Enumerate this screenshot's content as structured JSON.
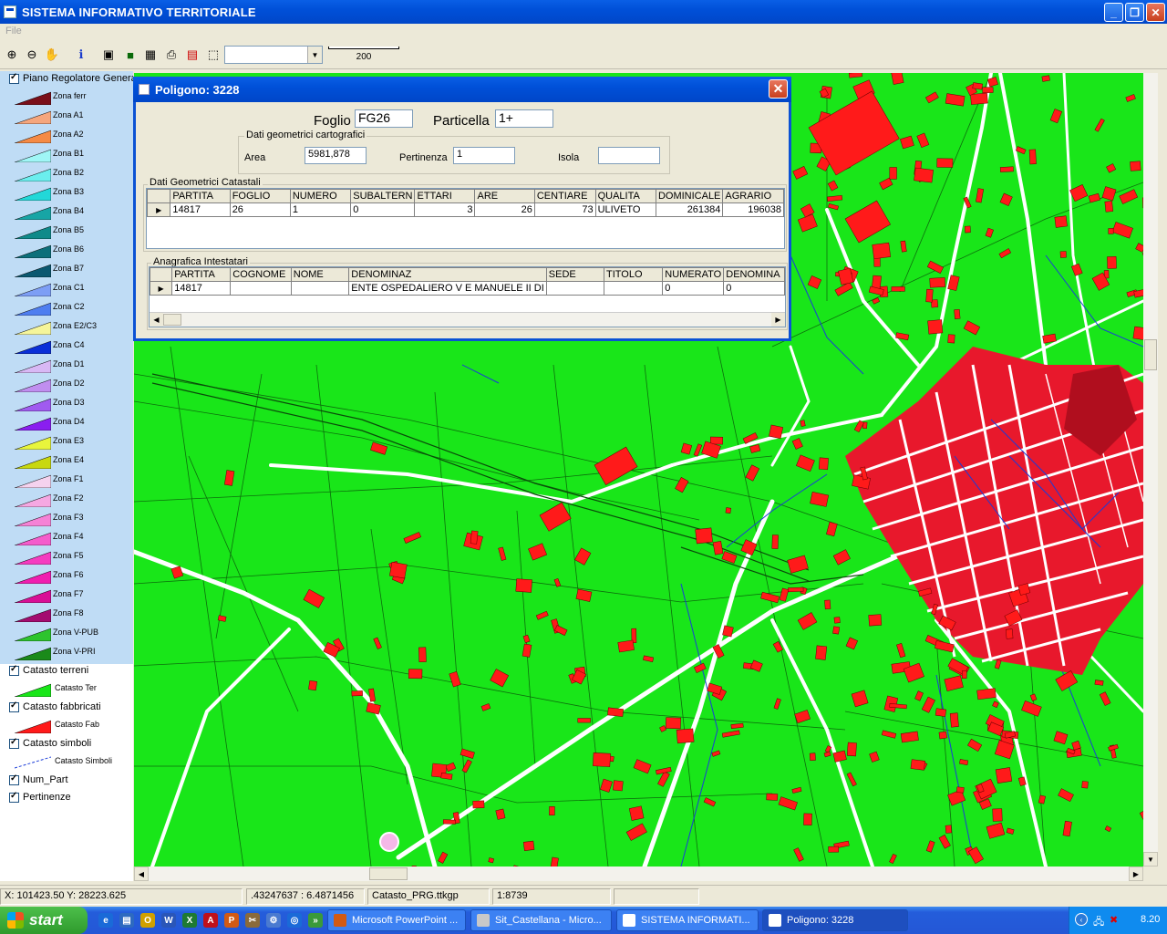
{
  "window": {
    "title": "SISTEMA INFORMATIVO TERRITORIALE"
  },
  "menu": {
    "file": "File"
  },
  "toolbar": {
    "icons": [
      "zoom-in-icon",
      "zoom-out-icon",
      "pan-icon",
      "info-icon",
      "layer-icon",
      "fill-icon",
      "table-icon",
      "print-icon",
      "export-icon",
      "select-icon"
    ],
    "scale_label": "200",
    "combo_value": ""
  },
  "legend": {
    "groups": [
      {
        "label": "Piano Regolatore Generale"
      },
      {
        "label": "Catasto terreni",
        "item": "Catasto Ter"
      },
      {
        "label": "Catasto fabbricati",
        "item": "Catasto Fab"
      },
      {
        "label": "Catasto simboli",
        "item": "Catasto Simboli"
      },
      {
        "label": "Num_Part"
      },
      {
        "label": "Pertinenze"
      }
    ],
    "zones": [
      {
        "name": "Zona ferr",
        "color": "#7a0f1a"
      },
      {
        "name": "Zona A1",
        "color": "#f5a67d"
      },
      {
        "name": "Zona A2",
        "color": "#f58a45"
      },
      {
        "name": "Zona B1",
        "color": "#9ff6f6"
      },
      {
        "name": "Zona B2",
        "color": "#6beeee"
      },
      {
        "name": "Zona B3",
        "color": "#22d8d8"
      },
      {
        "name": "Zona B4",
        "color": "#17a5a5"
      },
      {
        "name": "Zona B5",
        "color": "#0f8a8a"
      },
      {
        "name": "Zona B6",
        "color": "#0c6f7a"
      },
      {
        "name": "Zona B7",
        "color": "#0b5870"
      },
      {
        "name": "Zona C1",
        "color": "#7d9ef5"
      },
      {
        "name": "Zona C2",
        "color": "#4e7ef0"
      },
      {
        "name": "Zona E2/C3",
        "color": "#f5f59a"
      },
      {
        "name": "Zona C4",
        "color": "#0a2fd8"
      },
      {
        "name": "Zona D1",
        "color": "#d8b8f5"
      },
      {
        "name": "Zona D2",
        "color": "#c08ef0"
      },
      {
        "name": "Zona D3",
        "color": "#a05bf0"
      },
      {
        "name": "Zona D4",
        "color": "#8a1ef0"
      },
      {
        "name": "Zona E3",
        "color": "#e8f53c"
      },
      {
        "name": "Zona E4",
        "color": "#c8d80f"
      },
      {
        "name": "Zona F1",
        "color": "#f5d2ee"
      },
      {
        "name": "Zona F2",
        "color": "#f5a8e2"
      },
      {
        "name": "Zona F3",
        "color": "#f582d6"
      },
      {
        "name": "Zona F4",
        "color": "#f55ccc"
      },
      {
        "name": "Zona F5",
        "color": "#f53cc0"
      },
      {
        "name": "Zona F6",
        "color": "#f01eb0"
      },
      {
        "name": "Zona F7",
        "color": "#d80f96"
      },
      {
        "name": "Zona F8",
        "color": "#a30c70"
      },
      {
        "name": "Zona V-PUB",
        "color": "#2ec42e"
      },
      {
        "name": "Zona V-PRI",
        "color": "#1a8a1a"
      }
    ],
    "layer_colors": {
      "terreni": "#19e619",
      "fabbricati": "#ff1a1a",
      "simboli": "#1a3cd8"
    }
  },
  "dialog": {
    "title": "Poligono:  3228",
    "foglio_label": "Foglio",
    "foglio_value": "FG26",
    "particella_label": "Particella",
    "particella_value": "1+",
    "geo_group": "Dati  geometrici cartografici",
    "area_label": "Area",
    "area_value": "5981,878",
    "pertinenza_label": "Pertinenza",
    "pertinenza_value": "1",
    "isola_label": "Isola",
    "isola_value": "",
    "catastali_group": "Dati Geometrici Catastali",
    "catastali_headers": [
      "PARTITA",
      "FOGLIO",
      "NUMERO",
      "SUBALTERN",
      "ETTARI",
      "ARE",
      "CENTIARE",
      "QUALITA",
      "DOMINICALE",
      "AGRARIO"
    ],
    "catastali_rows": [
      [
        "14817",
        "26",
        "1",
        "0",
        "3",
        "26",
        "73",
        "ULIVETO",
        "261384",
        "196038"
      ]
    ],
    "anagrafica_group": "Anagrafica Intestatari",
    "anagrafica_headers": [
      "PARTITA",
      "COGNOME",
      "NOME",
      "DENOMINAZ",
      "SEDE",
      "TITOLO",
      "NUMERATO",
      "DENOMINA"
    ],
    "anagrafica_rows": [
      [
        "14817",
        "",
        "",
        "ENTE OSPEDALIERO V E MANUELE II DI",
        "",
        "",
        "0",
        "0"
      ]
    ]
  },
  "status": {
    "coords": "X: 101423.50 Y: 28223.625",
    "latlon": ".43247637 : 6.4871456",
    "file": "Catasto_PRG.ttkgp",
    "scale": "1:8739"
  },
  "taskbar": {
    "start": "start",
    "tasks": [
      "Microsoft PowerPoint ...",
      "Sit_Castellana - Micro...",
      "SISTEMA INFORMATI...",
      "Poligono:  3228"
    ],
    "clock": "8.20"
  }
}
